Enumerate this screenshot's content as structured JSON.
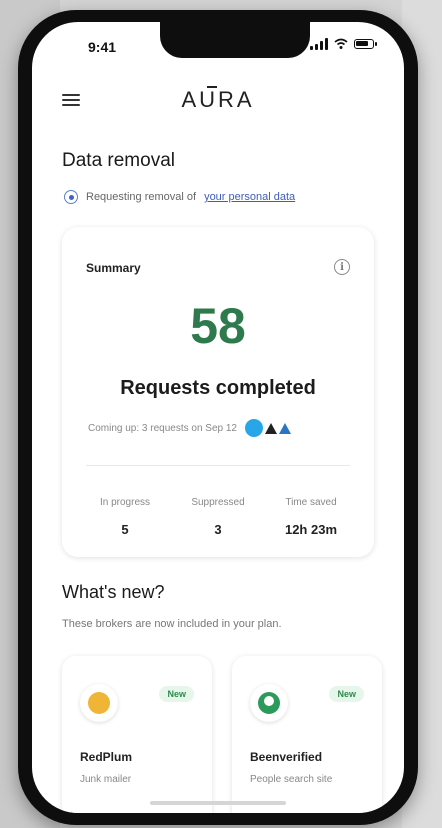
{
  "status_bar": {
    "time": "9:41"
  },
  "header": {
    "logo_text": "AURA"
  },
  "page": {
    "title": "Data removal",
    "removal_status_prefix": "Requesting removal of",
    "removal_status_link": "your personal data"
  },
  "summary": {
    "title": "Summary",
    "completed_count": "58",
    "completed_label": "Requests completed",
    "upcoming_text": "Coming up: 3 requests on Sep 12",
    "stats": [
      {
        "label": "In progress",
        "value": "5"
      },
      {
        "label": "Suppressed",
        "value": "3"
      },
      {
        "label": "Time saved",
        "value": "12h 23m"
      }
    ]
  },
  "whats_new": {
    "title": "What's new?",
    "subtitle": "These brokers are now included in your plan.",
    "brokers": [
      {
        "badge": "New",
        "name": "RedPlum",
        "type": "Junk mailer",
        "icon": "redplum-logo-icon"
      },
      {
        "badge": "New",
        "name": "Beenverified",
        "type": "People search site",
        "icon": "beenverified-logo-icon"
      }
    ]
  },
  "colors": {
    "accent_green": "#2f7a4d",
    "link_blue": "#3e5fb5"
  }
}
